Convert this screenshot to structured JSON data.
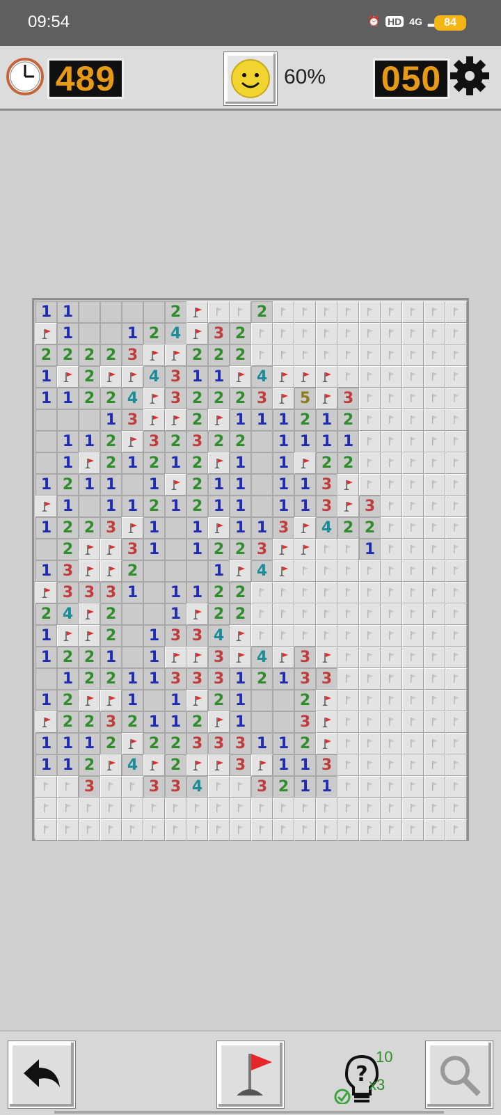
{
  "status_bar": {
    "time": "09:54",
    "network": "4G",
    "hd": "HD",
    "battery": "84"
  },
  "header": {
    "timer": "489",
    "percent": "60%",
    "mines_left": "050"
  },
  "hint": {
    "count": "10",
    "multiplier": "x3"
  },
  "board": {
    "rows": 25,
    "cols": 20,
    "cells": [
      [
        "1",
        "1",
        "0",
        "0",
        "0",
        "0",
        "2",
        "F",
        "H",
        "H",
        "2",
        "H",
        "H",
        "H",
        "H",
        "H",
        "H",
        "H",
        "H",
        "H"
      ],
      [
        "F",
        "1",
        "0",
        "0",
        "1",
        "2",
        "4",
        "F",
        "3",
        "2",
        "H",
        "H",
        "H",
        "H",
        "H",
        "H",
        "H",
        "H",
        "H",
        "H"
      ],
      [
        "2",
        "2",
        "2",
        "2",
        "3",
        "F",
        "F",
        "2",
        "2",
        "2",
        "H",
        "H",
        "H",
        "H",
        "H",
        "H",
        "H",
        "H",
        "H",
        "H"
      ],
      [
        "1",
        "F",
        "2",
        "F",
        "F",
        "4",
        "3",
        "1",
        "1",
        "F",
        "4",
        "F",
        "F",
        "F",
        "H",
        "H",
        "H",
        "H",
        "H",
        "H"
      ],
      [
        "1",
        "1",
        "2",
        "2",
        "4",
        "F",
        "3",
        "2",
        "2",
        "2",
        "3",
        "F",
        "5",
        "F",
        "3",
        "H",
        "H",
        "H",
        "H",
        "H"
      ],
      [
        "0",
        "0",
        "0",
        "1",
        "3",
        "F",
        "F",
        "2",
        "F",
        "1",
        "1",
        "1",
        "2",
        "1",
        "2",
        "H",
        "H",
        "H",
        "H",
        "H"
      ],
      [
        "0",
        "1",
        "1",
        "2",
        "F",
        "3",
        "2",
        "3",
        "2",
        "2",
        "0",
        "1",
        "1",
        "1",
        "1",
        "H",
        "H",
        "H",
        "H",
        "H"
      ],
      [
        "0",
        "1",
        "F",
        "2",
        "1",
        "2",
        "1",
        "2",
        "F",
        "1",
        "0",
        "1",
        "F",
        "2",
        "2",
        "H",
        "H",
        "H",
        "H",
        "H"
      ],
      [
        "1",
        "2",
        "1",
        "1",
        "0",
        "1",
        "F",
        "2",
        "1",
        "1",
        "0",
        "1",
        "1",
        "3",
        "F",
        "H",
        "H",
        "H",
        "H",
        "H"
      ],
      [
        "F",
        "1",
        "0",
        "1",
        "1",
        "2",
        "1",
        "2",
        "1",
        "1",
        "0",
        "1",
        "1",
        "3",
        "F",
        "3",
        "H",
        "H",
        "H",
        "H"
      ],
      [
        "1",
        "2",
        "2",
        "3",
        "F",
        "1",
        "0",
        "1",
        "F",
        "1",
        "1",
        "3",
        "F",
        "4",
        "2",
        "2",
        "H",
        "H",
        "H",
        "H"
      ],
      [
        "0",
        "2",
        "F",
        "F",
        "3",
        "1",
        "0",
        "1",
        "2",
        "2",
        "3",
        "F",
        "F",
        "H",
        "H",
        "1",
        "H",
        "H",
        "H",
        "H"
      ],
      [
        "1",
        "3",
        "F",
        "F",
        "2",
        "0",
        "0",
        "0",
        "1",
        "F",
        "4",
        "F",
        "H",
        "H",
        "H",
        "H",
        "H",
        "H",
        "H",
        "H"
      ],
      [
        "F",
        "3",
        "3",
        "3",
        "1",
        "0",
        "1",
        "1",
        "2",
        "2",
        "H",
        "H",
        "H",
        "H",
        "H",
        "H",
        "H",
        "H",
        "H",
        "H"
      ],
      [
        "2",
        "4",
        "F",
        "2",
        "0",
        "0",
        "1",
        "F",
        "2",
        "2",
        "H",
        "H",
        "H",
        "H",
        "H",
        "H",
        "H",
        "H",
        "H",
        "H"
      ],
      [
        "1",
        "F",
        "F",
        "2",
        "0",
        "1",
        "3",
        "3",
        "4",
        "F",
        "H",
        "H",
        "H",
        "H",
        "H",
        "H",
        "H",
        "H",
        "H",
        "H"
      ],
      [
        "1",
        "2",
        "2",
        "1",
        "0",
        "1",
        "F",
        "F",
        "3",
        "F",
        "4",
        "F",
        "3",
        "F",
        "H",
        "H",
        "H",
        "H",
        "H",
        "H"
      ],
      [
        "0",
        "1",
        "2",
        "2",
        "1",
        "1",
        "3",
        "3",
        "3",
        "1",
        "2",
        "1",
        "3",
        "3",
        "H",
        "H",
        "H",
        "H",
        "H",
        "H"
      ],
      [
        "1",
        "2",
        "F",
        "F",
        "1",
        "0",
        "1",
        "F",
        "2",
        "1",
        "0",
        "0",
        "2",
        "F",
        "H",
        "H",
        "H",
        "H",
        "H",
        "H"
      ],
      [
        "F",
        "2",
        "2",
        "3",
        "2",
        "1",
        "1",
        "2",
        "F",
        "1",
        "0",
        "0",
        "3",
        "F",
        "H",
        "H",
        "H",
        "H",
        "H",
        "H"
      ],
      [
        "1",
        "1",
        "1",
        "2",
        "F",
        "2",
        "2",
        "3",
        "3",
        "3",
        "1",
        "1",
        "2",
        "F",
        "H",
        "H",
        "H",
        "H",
        "H",
        "H"
      ],
      [
        "1",
        "1",
        "2",
        "F",
        "4",
        "F",
        "2",
        "F",
        "F",
        "3",
        "F",
        "1",
        "1",
        "3",
        "H",
        "H",
        "H",
        "H",
        "H",
        "H"
      ],
      [
        "H",
        "H",
        "3",
        "H",
        "H",
        "3",
        "3",
        "4",
        "H",
        "H",
        "3",
        "2",
        "1",
        "1",
        "H",
        "H",
        "H",
        "H",
        "H",
        "H"
      ],
      [
        "H",
        "H",
        "H",
        "H",
        "H",
        "H",
        "H",
        "H",
        "H",
        "H",
        "H",
        "H",
        "H",
        "H",
        "H",
        "H",
        "H",
        "H",
        "H",
        "H"
      ],
      [
        "H",
        "H",
        "H",
        "H",
        "H",
        "H",
        "H",
        "H",
        "H",
        "H",
        "H",
        "H",
        "H",
        "H",
        "H",
        "H",
        "H",
        "H",
        "H",
        "H"
      ]
    ]
  }
}
